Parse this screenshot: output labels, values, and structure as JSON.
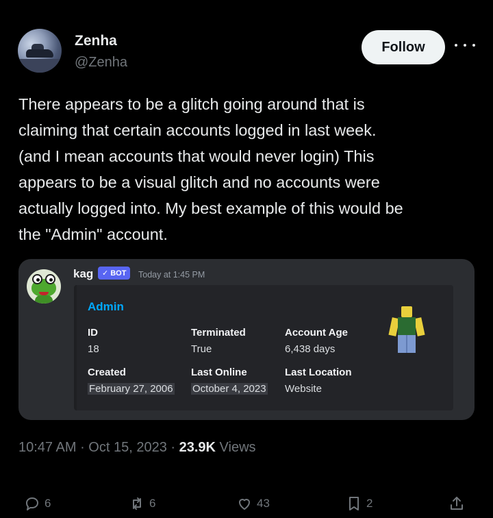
{
  "author": {
    "display_name": "Zenha",
    "handle": "@Zenha",
    "follow_label": "Follow",
    "more_icon": "more-horizontal-icon"
  },
  "tweet": {
    "lines": [
      "There appears to be a glitch going around that is",
      "claiming that certain accounts logged in last week.",
      "(and I mean accounts that would never login) This",
      "appears to be a visual glitch and no accounts were",
      "actually logged into. My best example of this would be",
      "the \"Admin\" account."
    ]
  },
  "discord": {
    "bot_name": "kag",
    "badge_check": "✓",
    "badge_label": "BOT",
    "timestamp": "Today at 1:45 PM",
    "embed": {
      "title": "Admin",
      "fields": {
        "id": {
          "name": "ID",
          "value": "18"
        },
        "terminated": {
          "name": "Terminated",
          "value": "True"
        },
        "account_age": {
          "name": "Account Age",
          "value": "6,438 days"
        },
        "created": {
          "name": "Created",
          "value": "February 27, 2006"
        },
        "last_online": {
          "name": "Last Online",
          "value": "October 4, 2023"
        },
        "last_location": {
          "name": "Last Location",
          "value": "Website"
        }
      }
    }
  },
  "meta": {
    "time": "10:47 AM",
    "separator": " · ",
    "date": "Oct 15, 2023",
    "views_count": "23.9K",
    "views_label": "Views"
  },
  "actions": {
    "replies": "6",
    "reposts": "6",
    "likes": "43",
    "bookmarks": "2"
  },
  "colors": {
    "background": "#000000",
    "text": "#e7e9ea",
    "muted": "#71767b",
    "discord_card": "#2b2d31",
    "embed_title": "#00a8fc",
    "bot_badge": "#5865f2"
  }
}
